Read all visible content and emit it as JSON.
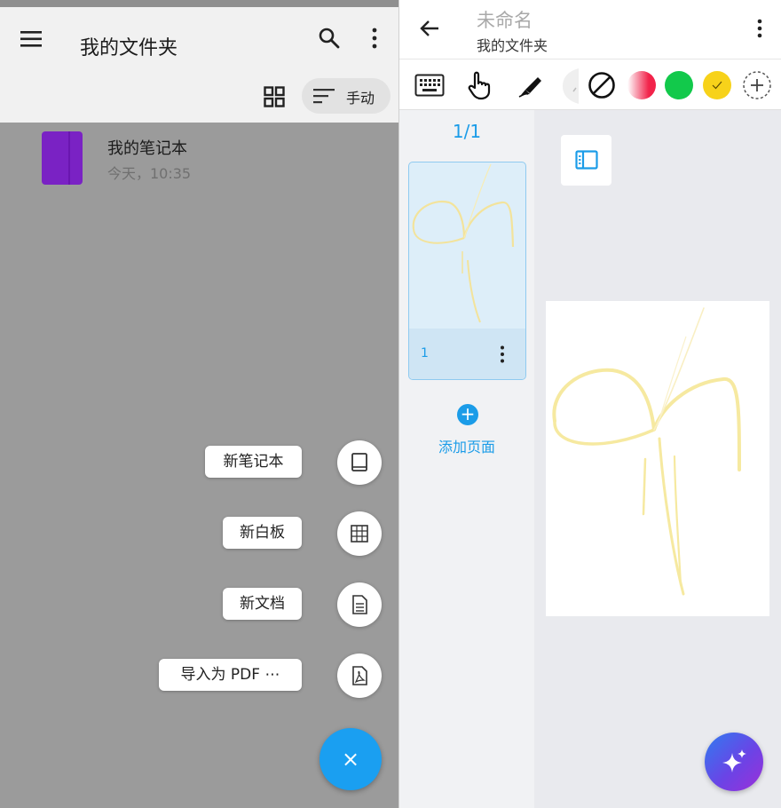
{
  "left": {
    "title": "我的文件夹",
    "sort_label": "手动",
    "notebooks": [
      {
        "name": "我的笔记本",
        "time": "今天，10:35",
        "cover_color": "#7a22c4"
      }
    ],
    "fab_menu": [
      {
        "label": "新笔记本",
        "icon": "book-icon"
      },
      {
        "label": "新白板",
        "icon": "grid-icon"
      },
      {
        "label": "新文档",
        "icon": "document-icon"
      },
      {
        "label": "导入为 PDF ⋯",
        "icon": "pdf-icon"
      }
    ],
    "fab_close": "×",
    "fab_color": "#1a9ff1"
  },
  "right": {
    "doc_title": "未命名",
    "doc_subtitle": "我的文件夹",
    "tools": [
      "keyboard-icon",
      "hand-touch-icon",
      "pen-icon",
      "highlighter-icon",
      "disable-touch-icon"
    ],
    "colors": [
      {
        "name": "red",
        "hex": "#f2234a"
      },
      {
        "name": "green",
        "hex": "#12c94b"
      },
      {
        "name": "yellow",
        "hex": "#f7d21a",
        "selected": true
      }
    ],
    "page_count": "1/1",
    "pages": [
      {
        "number": "1"
      }
    ],
    "add_page_label": "添加页面",
    "accent": "#1b9ce8",
    "ink_color": "#f6e9a0"
  }
}
